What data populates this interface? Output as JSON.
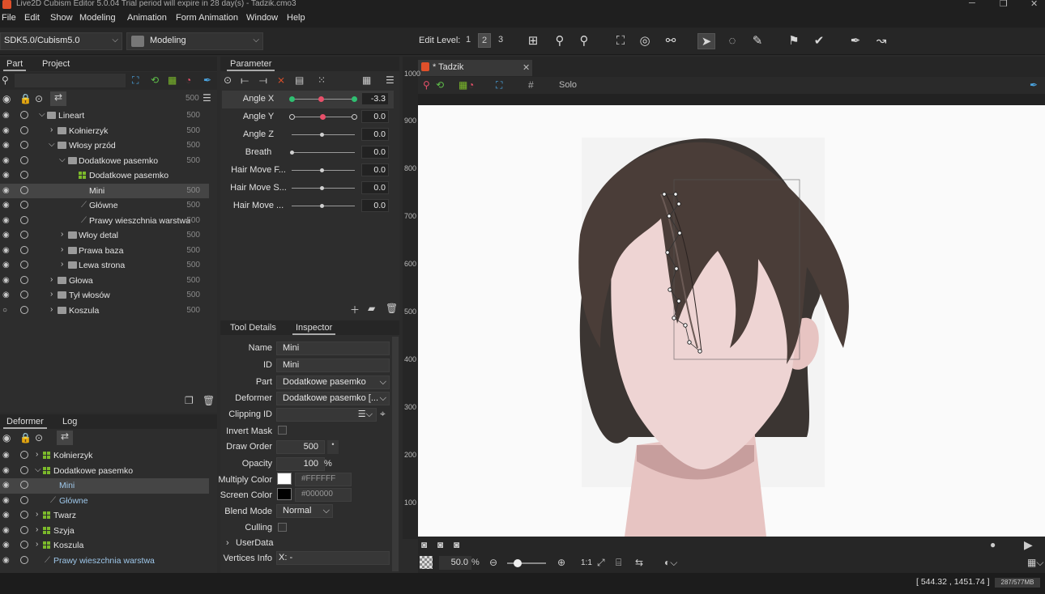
{
  "title": "Live2D Cubism Editor 5.0.04    Trial period will expire in 28 day(s)  - Tadzik.cmo3",
  "menu": [
    "File",
    "Edit",
    "Show",
    "Modeling",
    "Animation",
    "Form Animation",
    "Window",
    "Help"
  ],
  "toolbar": {
    "sdk": "SDK5.0/Cubism5.0",
    "mode": "Modeling",
    "edit_level_label": "Edit Level:",
    "levels": [
      "1",
      "2",
      "3"
    ]
  },
  "part_panel": {
    "tabs": [
      "Part",
      "Project"
    ],
    "header_num": "500",
    "rows": [
      {
        "label": "Lineart",
        "num": "500"
      },
      {
        "label": "Kołnierzyk",
        "num": "500"
      },
      {
        "label": "Włosy przód",
        "num": "500"
      },
      {
        "label": "Dodatkowe pasemko",
        "num": "500"
      },
      {
        "label": "Dodatkowe pasemko",
        "num": ""
      },
      {
        "label": "Mini",
        "num": "500"
      },
      {
        "label": "Główne",
        "num": "500"
      },
      {
        "label": "Prawy wieszchnia warstwa",
        "num": "500"
      },
      {
        "label": "Włoy detal",
        "num": "500"
      },
      {
        "label": "Prawa baza",
        "num": "500"
      },
      {
        "label": "Lewa strona",
        "num": "500"
      },
      {
        "label": "Głowa",
        "num": "500"
      },
      {
        "label": "Tył włosów",
        "num": "500"
      },
      {
        "label": "Koszula",
        "num": "500"
      }
    ]
  },
  "deformer_panel": {
    "tabs": [
      "Deformer",
      "Log"
    ],
    "rows": [
      {
        "label": "Kołnierzyk"
      },
      {
        "label": "Dodatkowe pasemko"
      },
      {
        "label": "Mini"
      },
      {
        "label": "Główne"
      },
      {
        "label": "Twarz"
      },
      {
        "label": "Szyja"
      },
      {
        "label": "Koszula"
      },
      {
        "label": "Prawy wieszchnia warstwa"
      }
    ]
  },
  "parameter_panel": {
    "tab": "Parameter",
    "params": [
      {
        "name": "Angle X",
        "value": "-3.3"
      },
      {
        "name": "Angle Y",
        "value": "0.0"
      },
      {
        "name": "Angle Z",
        "value": "0.0"
      },
      {
        "name": "Breath",
        "value": "0.0"
      },
      {
        "name": "Hair Move F...",
        "value": "0.0"
      },
      {
        "name": "Hair Move S...",
        "value": "0.0"
      },
      {
        "name": "Hair Move ...",
        "value": "0.0"
      }
    ]
  },
  "inspector": {
    "tabs": [
      "Tool Details",
      "Inspector"
    ],
    "name_label": "Name",
    "name_value": "Mini",
    "id_label": "ID",
    "id_value": "Mini",
    "part_label": "Part",
    "part_value": "Dodatkowe pasemko",
    "deformer_label": "Deformer",
    "deformer_value": "Dodatkowe pasemko  [...",
    "clipping_label": "Clipping ID",
    "invert_label": "Invert Mask",
    "draw_order_label": "Draw Order",
    "draw_order_value": "500",
    "opacity_label": "Opacity",
    "opacity_value": "100",
    "opacity_unit": "%",
    "multiply_label": "Multiply Color",
    "multiply_value": "#FFFFFF",
    "screen_label": "Screen Color",
    "screen_value": "#000000",
    "blend_label": "Blend Mode",
    "blend_value": "Normal",
    "culling_label": "Culling",
    "userdata_label": "UserData",
    "vertices_label": "Vertices Info",
    "vertices_x": "X: -"
  },
  "viewport": {
    "tab": "* Tadzik",
    "solo": "Solo",
    "ruler": [
      "1000",
      "900",
      "800",
      "700",
      "600",
      "500",
      "400",
      "300",
      "200",
      "100"
    ],
    "zoom": "50.0",
    "zoom_unit": "%",
    "ratio": "1:1"
  },
  "status": {
    "coords": "[ 544.32 , 1451.74 ]",
    "memory": "287/577MB"
  },
  "colors": {
    "accent": "#e0502a",
    "mesh_green": "#7cba2b",
    "knob_green": "#2fbf71",
    "knob_red": "#e8506a"
  }
}
